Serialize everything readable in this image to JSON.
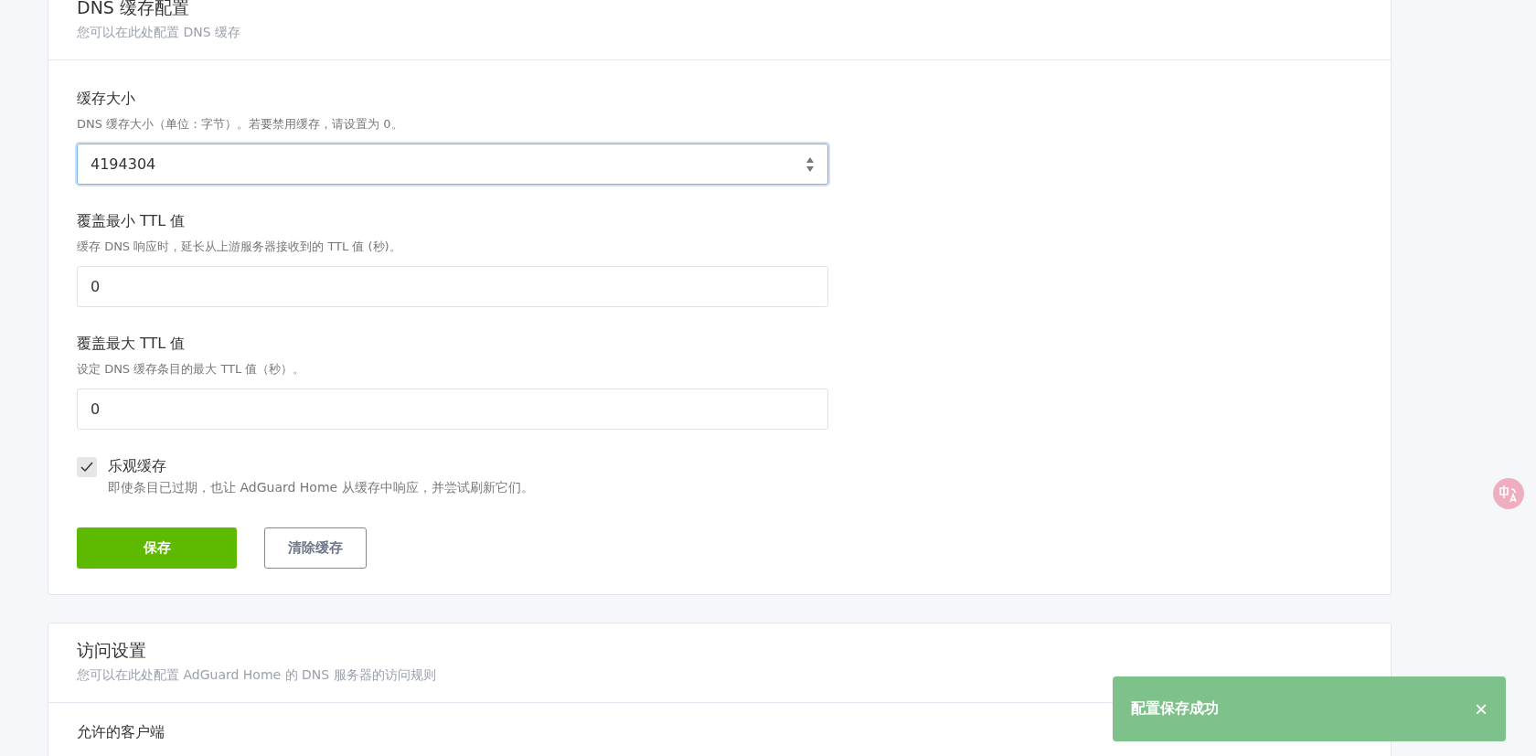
{
  "sections": [
    {
      "title": "DNS 缓存配置",
      "subtitle": "您可以在此处配置 DNS 缓存",
      "fields": [
        {
          "kind": "number",
          "label": "缓存大小",
          "help": "DNS 缓存大小（单位：字节）。若要禁用缓存，请设置为 0。",
          "value": "4194304",
          "focused": true
        },
        {
          "kind": "text",
          "label": "覆盖最小 TTL 值",
          "help": "缓存 DNS 响应时，延长从上游服务器接收到的 TTL 值 (秒)。",
          "value": "0",
          "focused": false
        },
        {
          "kind": "text",
          "label": "覆盖最大 TTL 值",
          "help": "设定 DNS 缓存条目的最大 TTL 值（秒）。",
          "value": "0",
          "focused": false
        },
        {
          "kind": "checkbox",
          "label": "乐观缓存",
          "help": "即使条目已过期，也让 AdGuard Home 从缓存中响应，并尝试刷新它们。",
          "checked": true
        }
      ],
      "buttons": [
        {
          "label": "保存",
          "kind": "primary"
        },
        {
          "label": "清除缓存",
          "kind": "outline"
        }
      ]
    },
    {
      "title": "访问设置",
      "subtitle": "您可以在此处配置 AdGuard Home 的 DNS 服务器的访问规则",
      "fields": [
        {
          "kind": "heading",
          "label": "允许的客户端"
        }
      ]
    }
  ],
  "toast": {
    "message": "配置保存成功",
    "close": "×"
  }
}
